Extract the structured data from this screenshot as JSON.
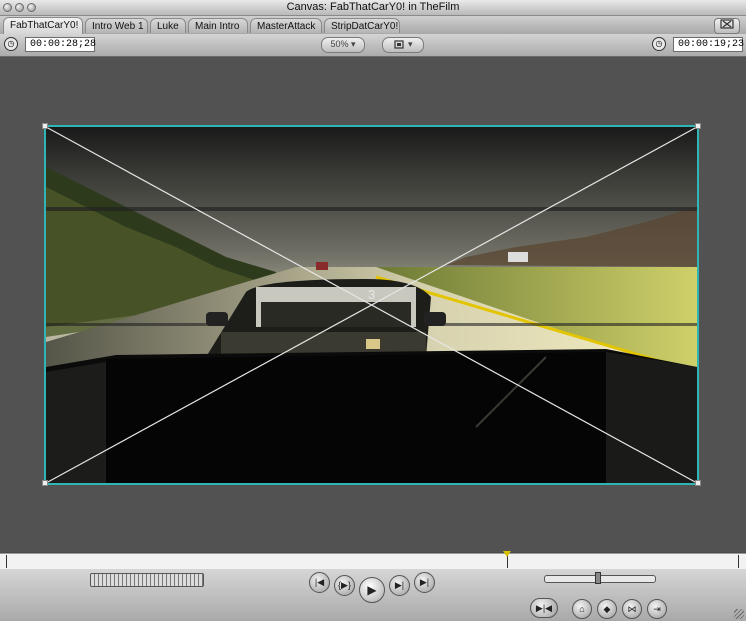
{
  "window": {
    "title": "Canvas: FabThatCarY0! in TheFilm"
  },
  "tabs": [
    {
      "label": "FabThatCarY0!",
      "active": true
    },
    {
      "label": "Intro Web 1",
      "active": false
    },
    {
      "label": "Luke",
      "active": false
    },
    {
      "label": "Main Intro",
      "active": false
    },
    {
      "label": "MasterAttack",
      "active": false
    },
    {
      "label": "StripDatCarY0!",
      "active": false
    }
  ],
  "controls": {
    "duration_timecode": "00:00:28;28",
    "current_timecode": "00:00:19;23",
    "zoom": "50%",
    "view_mode_icon": "view-mode-icon"
  },
  "video": {
    "overlay_number": "3",
    "frame_border_color": "#2fb5b5"
  },
  "timeline": {
    "playhead_fraction": 0.68
  },
  "transport": {
    "icons": [
      "go-to-previous-edit-icon",
      "play-in-to-out-icon",
      "play-icon",
      "play-around-icon",
      "go-to-next-edit-icon"
    ]
  }
}
